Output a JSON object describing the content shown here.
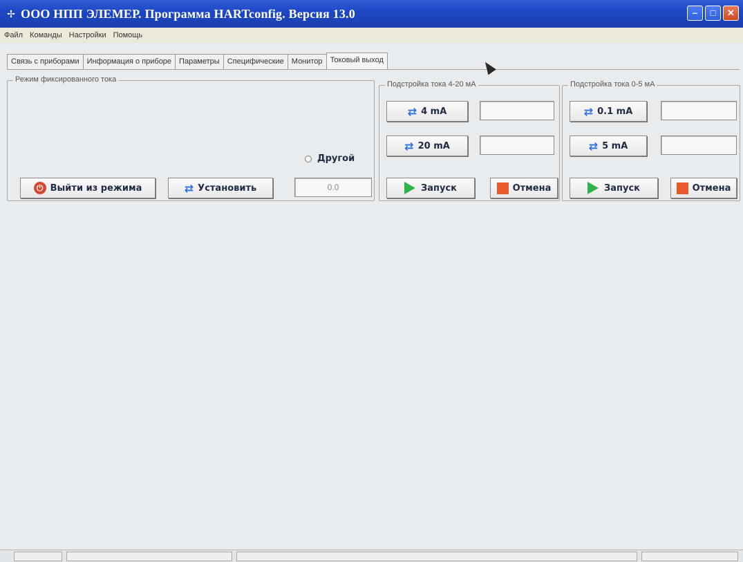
{
  "window": {
    "title": "ООО НПП ЭЛЕМЕР.  Программа HARTconfig.  Версия 13.0",
    "controls": {
      "minimize": "–",
      "maximize": "□",
      "close": "✕"
    }
  },
  "menu": [
    "Файл",
    "Команды",
    "Настройки",
    "Помощь"
  ],
  "tabs": [
    {
      "label": "Связь с приборами",
      "active": false
    },
    {
      "label": "Информация о приборе",
      "active": false
    },
    {
      "label": "Параметры",
      "active": false
    },
    {
      "label": "Специфические",
      "active": false
    },
    {
      "label": "Монитор",
      "active": false
    },
    {
      "label": "Токовый выход",
      "active": true
    }
  ],
  "fixed_current": {
    "label": "Режим фиксированного тока",
    "radio_other": "Другой",
    "exit_button": "Выйти из режима",
    "set_button": "Установить",
    "value": "0.0"
  },
  "trim_4_20": {
    "label": "Подстройка тока 4-20 мА",
    "btn_4": "4 mA",
    "btn_20": "20 mA",
    "start": "Запуск",
    "cancel": "Отмена"
  },
  "trim_0_5": {
    "label": "Подстройка тока 0-5 мА",
    "btn_01": "0.1 mA",
    "btn_5": "5 mA",
    "start": "Запуск",
    "cancel": "Отмена"
  },
  "icons": {
    "exit": "power-icon",
    "send": "arrow-send-icon",
    "start": "play-icon",
    "cancel": "stop-icon"
  },
  "colors": {
    "titlebar": "#1d46c4",
    "start_icon": "#2fb34a",
    "cancel_icon": "#e85a2c",
    "arrow_icon": "#2a6fe0"
  }
}
